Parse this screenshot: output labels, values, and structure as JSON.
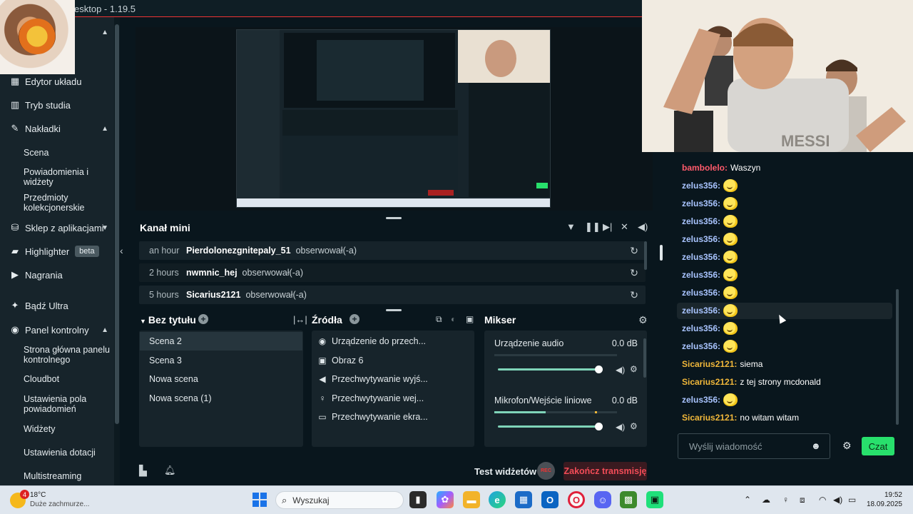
{
  "window": {
    "title": "esktop - 1.19.5"
  },
  "sidebar": {
    "items": [
      {
        "label": "Edytor układu",
        "icon": "layout-icon"
      },
      {
        "label": "Tryb studia",
        "icon": "studio-icon"
      },
      {
        "label": "Nakładki",
        "icon": "overlays-icon"
      },
      {
        "label": "Scena"
      },
      {
        "label": "Powiadomienia i widżety"
      },
      {
        "label": "Przedmioty kolekcjonerskie"
      },
      {
        "label": "Sklep z aplikacjami",
        "icon": "store-icon"
      },
      {
        "label": "Highlighter",
        "icon": "highlighter-icon",
        "badge": "beta"
      },
      {
        "label": "Nagrania",
        "icon": "recordings-icon"
      },
      {
        "label": "Bądź Ultra",
        "icon": "ultra-icon"
      },
      {
        "label": "Panel kontrolny",
        "icon": "dashboard-icon"
      },
      {
        "label": "Strona główna panelu kontrolnego"
      },
      {
        "label": "Cloudbot"
      },
      {
        "label": "Ustawienia pola powiadomień"
      },
      {
        "label": "Widżety"
      },
      {
        "label": "Ustawienia dotacji"
      },
      {
        "label": "Multistreaming"
      }
    ]
  },
  "feed": {
    "title": "Kanał mini",
    "rows": [
      {
        "time": "an hour",
        "user": "Pierdolonezgnitepaly_51",
        "action": "obserwował(-a)"
      },
      {
        "time": "2 hours",
        "user": "nwmnic_hej",
        "action": "obserwował(-a)"
      },
      {
        "time": "5 hours",
        "user": "Sicarius2121",
        "action": "obserwował(-a)"
      }
    ]
  },
  "scenes": {
    "title": "Bez tytułu",
    "items": [
      "Scena 2",
      "Scena 3",
      "Nowa scena",
      "Nowa scena (1)"
    ],
    "active_index": 0
  },
  "sources": {
    "title": "Źródła",
    "items": [
      {
        "label": "Urządzenie do przech...",
        "icon": "webcam-icon"
      },
      {
        "label": "Obraz 6",
        "icon": "image-icon"
      },
      {
        "label": "Przechwytywanie wyjś...",
        "icon": "speaker-icon"
      },
      {
        "label": "Przechwytywanie wej...",
        "icon": "microphone-icon"
      },
      {
        "label": "Przechwytywanie ekra...",
        "icon": "monitor-icon"
      }
    ]
  },
  "mixer": {
    "title": "Mikser",
    "channels": [
      {
        "label": "Urządzenie audio",
        "db": "0.0 dB",
        "level": 1.0
      },
      {
        "label": "Mikrofon/Wejście liniowe",
        "db": "0.0 dB",
        "level": 1.0
      }
    ]
  },
  "bottombar": {
    "test_widgets": "Test widżetów",
    "rec_label": "REC",
    "end_stream": "Zakończ transmisję"
  },
  "chat": {
    "messages": [
      {
        "user": "bambolelo",
        "color": "#ff5a6b",
        "text": "Waszyn",
        "emote": false
      },
      {
        "user": "zelus356",
        "color": "#a9c4ff",
        "text": "",
        "emote": true
      },
      {
        "user": "zelus356",
        "color": "#a9c4ff",
        "text": "",
        "emote": true
      },
      {
        "user": "zelus356",
        "color": "#a9c4ff",
        "text": "",
        "emote": true
      },
      {
        "user": "zelus356",
        "color": "#a9c4ff",
        "text": "",
        "emote": true
      },
      {
        "user": "zelus356",
        "color": "#a9c4ff",
        "text": "",
        "emote": true
      },
      {
        "user": "zelus356",
        "color": "#a9c4ff",
        "text": "",
        "emote": true
      },
      {
        "user": "zelus356",
        "color": "#a9c4ff",
        "text": "",
        "emote": true
      },
      {
        "user": "zelus356",
        "color": "#a9c4ff",
        "text": "",
        "emote": true
      },
      {
        "user": "zelus356",
        "color": "#a9c4ff",
        "text": "",
        "emote": true
      },
      {
        "user": "zelus356",
        "color": "#a9c4ff",
        "text": "",
        "emote": true
      },
      {
        "user": "Sicarius2121",
        "color": "#f0b73a",
        "text": "siema",
        "emote": false
      },
      {
        "user": "Sicarius2121",
        "color": "#f0b73a",
        "text": "z tej strony mcdonald",
        "emote": false
      },
      {
        "user": "zelus356",
        "color": "#a9c4ff",
        "text": "",
        "emote": true
      },
      {
        "user": "Sicarius2121",
        "color": "#f0b73a",
        "text": "no witam witam",
        "emote": false
      }
    ],
    "input_placeholder": "Wyślij wiadomość",
    "send_label": "Czat"
  },
  "taskbar": {
    "weather_temp": "18°C",
    "weather_desc": "Duże zachmurze...",
    "weather_badge": "4",
    "search_placeholder": "Wyszukaj",
    "time": "19:52",
    "date": "18.09.2025"
  },
  "colors": {
    "accent_green": "#28e06c",
    "danger": "#f24c57",
    "panel": "#17242b",
    "background": "#09161d"
  }
}
